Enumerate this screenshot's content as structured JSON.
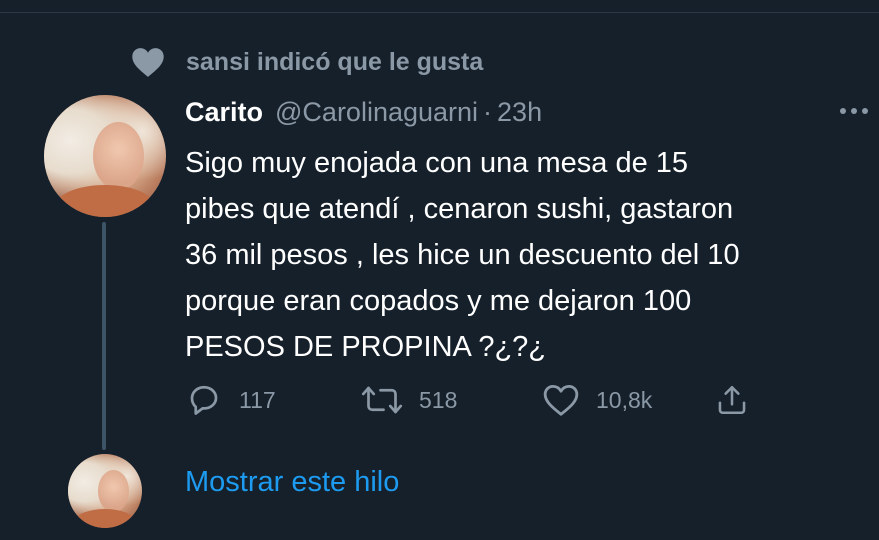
{
  "social_context": {
    "text": "sansi indicó que le gusta",
    "icon": "heart-icon"
  },
  "tweet": {
    "author_name": "Carito",
    "author_handle": "@Carolinaguarni",
    "separator": "·",
    "time": "23h",
    "lines": [
      "Sigo muy enojada con una mesa de 15",
      "pibes que atendí , cenaron sushi, gastaron",
      "36 mil pesos , les hice un descuento del 10",
      "porque eran copados y me dejaron 100",
      "PESOS DE PROPINA ?¿?¿"
    ],
    "actions": {
      "replies": "117",
      "retweets": "518",
      "likes": "10,8k"
    }
  },
  "show_thread_label": "Mostrar este hilo",
  "colors": {
    "background": "#15202b",
    "secondary_text": "#8b98a5",
    "link": "#1d9bf0",
    "thread_line": "#3d5466"
  }
}
